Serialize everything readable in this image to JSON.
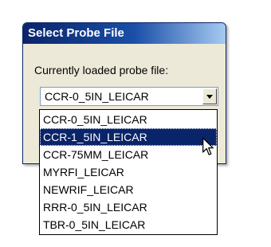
{
  "dialog": {
    "title": "Select Probe File",
    "prompt": "Currently loaded probe file:"
  },
  "combo": {
    "value": "CCR-0_5IN_LEICAR",
    "button_icon": "chevron-down-icon"
  },
  "dropdown": {
    "options": [
      "CCR-0_5IN_LEICAR",
      "CCR-1_5IN_LEICAR",
      "CCR-75MM_LEICAR",
      "MYRFI_LEICAR",
      "NEWRIF_LEICAR",
      "RRR-0_5IN_LEICAR",
      "TBR-0_5IN_LEICAR"
    ],
    "selected_index": 1
  },
  "colors": {
    "titlebar_start": "#0a246a",
    "titlebar_end": "#a6caf0",
    "selection": "#0a246a",
    "dialog_bg": "#ece9d8"
  },
  "pointer_icon": "arrow-cursor-icon"
}
